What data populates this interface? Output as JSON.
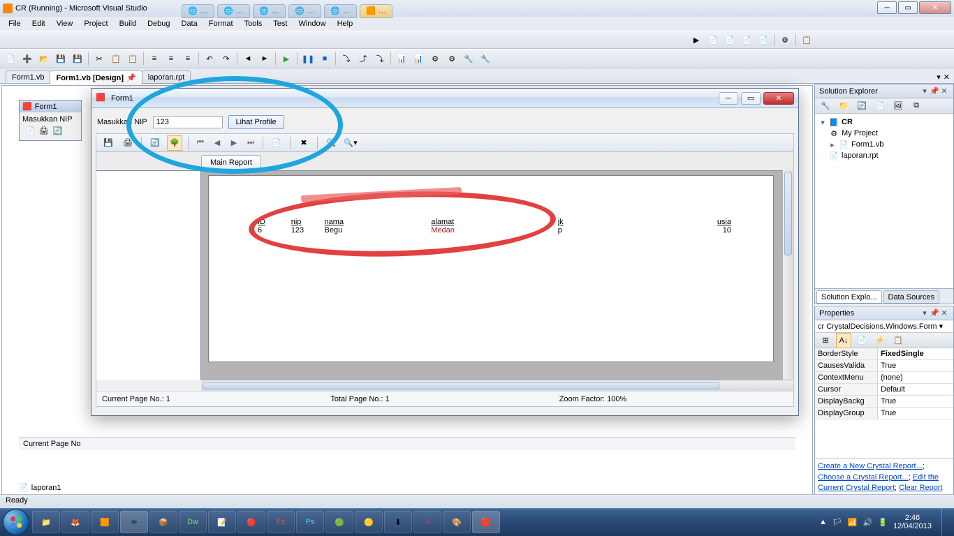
{
  "vs_title": "CR (Running) - Microsoft Visual Studio",
  "menu": [
    "File",
    "Edit",
    "View",
    "Project",
    "Build",
    "Debug",
    "Data",
    "Format",
    "Tools",
    "Test",
    "Window",
    "Help"
  ],
  "doc_tabs": [
    {
      "label": "Form1.vb",
      "active": false,
      "pinned": false
    },
    {
      "label": "Form1.vb [Design]",
      "active": true,
      "pinned": true
    },
    {
      "label": "laporan.rpt",
      "active": false,
      "pinned": false
    }
  ],
  "form_preview": {
    "title": "Form1",
    "label": "Masukkan NIP"
  },
  "designer_status": "Current Page No",
  "laporan_ref": "laporan1",
  "run_form": {
    "title": "Form1",
    "input_label": "Masukkan NIP",
    "input_value": "123",
    "button_label": "Lihat Profile",
    "main_report_tab": "Main Report",
    "status": {
      "current": "Current Page No.: 1",
      "total": "Total Page No.: 1",
      "zoom": "Zoom Factor: 100%"
    },
    "report_columns": [
      {
        "header": "ID",
        "value": "6",
        "cls": "c-id"
      },
      {
        "header": "nip",
        "value": "123",
        "cls": "c-nip"
      },
      {
        "header": "nama",
        "value": "Begu",
        "cls": "c-nama"
      },
      {
        "header": "alamat",
        "value": "Medan",
        "cls": "c-alamat"
      },
      {
        "header": "jk",
        "value": "p",
        "cls": "c-jk"
      },
      {
        "header": "usia",
        "value": "10",
        "cls": "c-usia"
      }
    ]
  },
  "solution_explorer": {
    "title": "Solution Explorer",
    "root": "CR",
    "items": [
      "My Project",
      "Form1.vb",
      "laporan.rpt"
    ]
  },
  "solution_tabs": [
    "Solution Explo...",
    "Data Sources"
  ],
  "properties": {
    "title": "Properties",
    "object": "cr CrystalDecisions.Windows.Form",
    "rows": [
      {
        "k": "BorderStyle",
        "v": "FixedSingle",
        "bold": true
      },
      {
        "k": "CausesValida",
        "v": "True"
      },
      {
        "k": "ContextMenu",
        "v": "(none)"
      },
      {
        "k": "Cursor",
        "v": "Default"
      },
      {
        "k": "DisplayBackg",
        "v": "True"
      },
      {
        "k": "DisplayGroup",
        "v": "True"
      }
    ],
    "links": [
      "Create a New Crystal Report...;",
      "Choose a Crystal Report...; ",
      "Edit the Current Crystal Report; ",
      "Clear Report Source"
    ],
    "links_row1": "Create a New Crystal Report...",
    "links_row2a": "Choose a Crystal Report...",
    "links_row2b": "Edit the Current Crystal Report",
    "links_row3a": "Clear Report Source"
  },
  "vs_status": "Ready",
  "clock": {
    "time": "2:46",
    "date": "12/04/2013"
  }
}
